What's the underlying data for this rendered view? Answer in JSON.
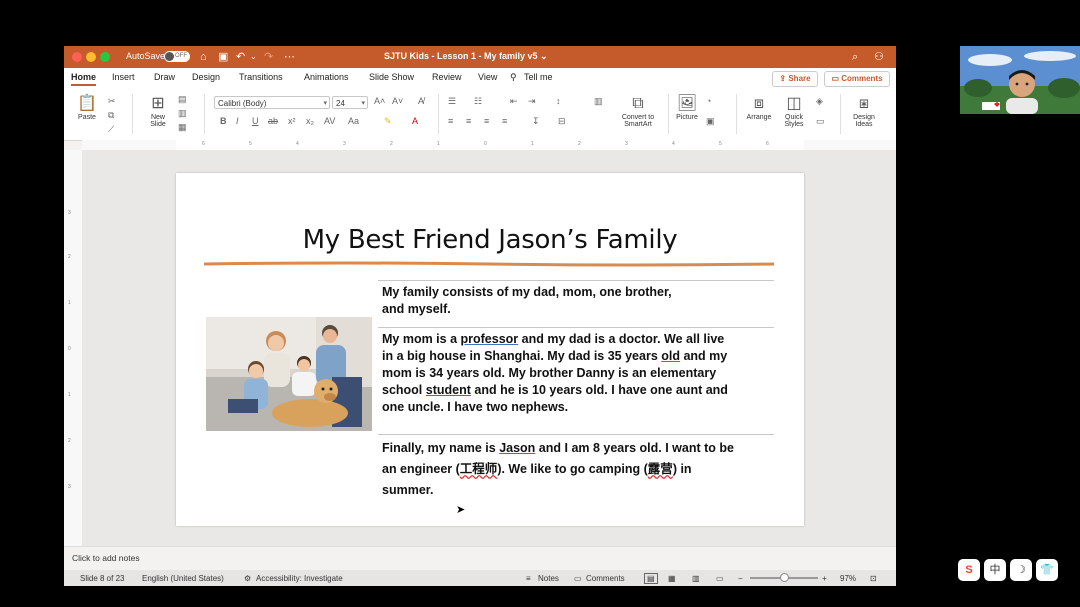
{
  "titlebar": {
    "autosave_label": "AutoSave",
    "autosave_state": "OFF",
    "doc_title": "SJTU Kids - Lesson 1 - My family v5 ⌄"
  },
  "tabs": [
    "Home",
    "Insert",
    "Draw",
    "Design",
    "Transitions",
    "Animations",
    "Slide Show",
    "Review",
    "View"
  ],
  "tell_me": "Tell me",
  "share_label": "Share",
  "comments_label": "Comments",
  "ribbon": {
    "paste": "Paste",
    "new_slide_line1": "New",
    "new_slide_line2": "Slide",
    "font_name": "Calibri (Body)",
    "font_size": "24",
    "convert_line1": "Convert to",
    "convert_line2": "SmartArt",
    "picture": "Picture",
    "arrange": "Arrange",
    "quick_line1": "Quick",
    "quick_line2": "Styles",
    "design_line1": "Design",
    "design_line2": "Ideas"
  },
  "ruler_h": [
    "6",
    "5",
    "4",
    "3",
    "2",
    "1",
    "0",
    "1",
    "2",
    "3",
    "4",
    "5",
    "6"
  ],
  "ruler_v": [
    "3",
    "2",
    "1",
    "0",
    "1",
    "2",
    "3"
  ],
  "slide": {
    "title": "My Best Friend Jason’s Family",
    "p1_l1": "My family consists of my dad, mom, one brother,",
    "p1_l2": "and myself.",
    "p2_l1_a": "My mom is a ",
    "p2_l1_u": "professor",
    "p2_l1_b": " and my dad is a doctor. We all live",
    "p2_l2_a": "in a big house in Shanghai.  My dad is 35 years ",
    "p2_l2_u": "old",
    "p2_l2_b": " and my",
    "p2_l3": "mom is 34 years old. My brother Danny is an elementary",
    "p2_l4_a": "school ",
    "p2_l4_u": "student",
    "p2_l4_b": " and he is 10 years old.  I have one aunt and",
    "p2_l5": "one uncle. I have two nephews.",
    "p3_l1_a": "Finally,  my name is ",
    "p3_l1_u": "Jason",
    "p3_l1_b": " and I am 8 years old. I want to be",
    "p3_l2_a": "an engineer (",
    "p3_l2_u": "工程师",
    "p3_l2_b": "). We like to go camping (",
    "p3_l2_u2": "露营",
    "p3_l2_c": ") in",
    "p3_l3": "summer."
  },
  "notes_placeholder": "Click to add notes",
  "status": {
    "slide_pos": "Slide 8 of 23",
    "language": "English (United States)",
    "accessibility": "Accessibility: Investigate",
    "notes": "Notes",
    "comments": "Comments",
    "zoom": "97%"
  },
  "zoom_fraction": 0.5,
  "colors": {
    "accent": "#c55a2b",
    "underline": "#d98a4e"
  },
  "tray": [
    "S",
    "中",
    "☽",
    "👕"
  ]
}
